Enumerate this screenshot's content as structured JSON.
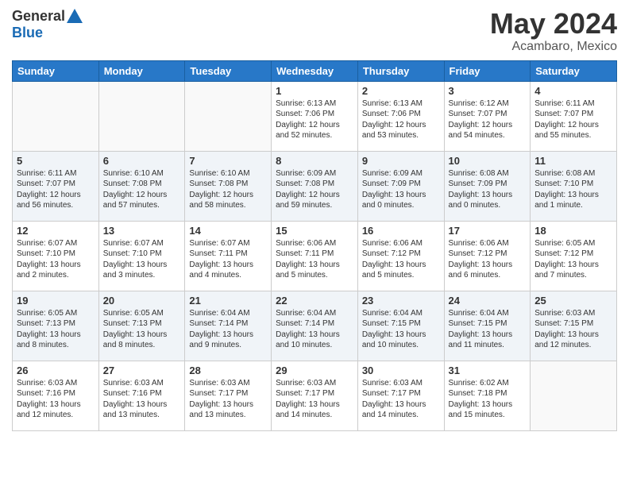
{
  "header": {
    "logo_general": "General",
    "logo_blue": "Blue",
    "title": "May 2024",
    "location": "Acambaro, Mexico"
  },
  "weekdays": [
    "Sunday",
    "Monday",
    "Tuesday",
    "Wednesday",
    "Thursday",
    "Friday",
    "Saturday"
  ],
  "weeks": [
    [
      {
        "day": "",
        "info": ""
      },
      {
        "day": "",
        "info": ""
      },
      {
        "day": "",
        "info": ""
      },
      {
        "day": "1",
        "info": "Sunrise: 6:13 AM\nSunset: 7:06 PM\nDaylight: 12 hours\nand 52 minutes."
      },
      {
        "day": "2",
        "info": "Sunrise: 6:13 AM\nSunset: 7:06 PM\nDaylight: 12 hours\nand 53 minutes."
      },
      {
        "day": "3",
        "info": "Sunrise: 6:12 AM\nSunset: 7:07 PM\nDaylight: 12 hours\nand 54 minutes."
      },
      {
        "day": "4",
        "info": "Sunrise: 6:11 AM\nSunset: 7:07 PM\nDaylight: 12 hours\nand 55 minutes."
      }
    ],
    [
      {
        "day": "5",
        "info": "Sunrise: 6:11 AM\nSunset: 7:07 PM\nDaylight: 12 hours\nand 56 minutes."
      },
      {
        "day": "6",
        "info": "Sunrise: 6:10 AM\nSunset: 7:08 PM\nDaylight: 12 hours\nand 57 minutes."
      },
      {
        "day": "7",
        "info": "Sunrise: 6:10 AM\nSunset: 7:08 PM\nDaylight: 12 hours\nand 58 minutes."
      },
      {
        "day": "8",
        "info": "Sunrise: 6:09 AM\nSunset: 7:08 PM\nDaylight: 12 hours\nand 59 minutes."
      },
      {
        "day": "9",
        "info": "Sunrise: 6:09 AM\nSunset: 7:09 PM\nDaylight: 13 hours\nand 0 minutes."
      },
      {
        "day": "10",
        "info": "Sunrise: 6:08 AM\nSunset: 7:09 PM\nDaylight: 13 hours\nand 0 minutes."
      },
      {
        "day": "11",
        "info": "Sunrise: 6:08 AM\nSunset: 7:10 PM\nDaylight: 13 hours\nand 1 minute."
      }
    ],
    [
      {
        "day": "12",
        "info": "Sunrise: 6:07 AM\nSunset: 7:10 PM\nDaylight: 13 hours\nand 2 minutes."
      },
      {
        "day": "13",
        "info": "Sunrise: 6:07 AM\nSunset: 7:10 PM\nDaylight: 13 hours\nand 3 minutes."
      },
      {
        "day": "14",
        "info": "Sunrise: 6:07 AM\nSunset: 7:11 PM\nDaylight: 13 hours\nand 4 minutes."
      },
      {
        "day": "15",
        "info": "Sunrise: 6:06 AM\nSunset: 7:11 PM\nDaylight: 13 hours\nand 5 minutes."
      },
      {
        "day": "16",
        "info": "Sunrise: 6:06 AM\nSunset: 7:12 PM\nDaylight: 13 hours\nand 5 minutes."
      },
      {
        "day": "17",
        "info": "Sunrise: 6:06 AM\nSunset: 7:12 PM\nDaylight: 13 hours\nand 6 minutes."
      },
      {
        "day": "18",
        "info": "Sunrise: 6:05 AM\nSunset: 7:12 PM\nDaylight: 13 hours\nand 7 minutes."
      }
    ],
    [
      {
        "day": "19",
        "info": "Sunrise: 6:05 AM\nSunset: 7:13 PM\nDaylight: 13 hours\nand 8 minutes."
      },
      {
        "day": "20",
        "info": "Sunrise: 6:05 AM\nSunset: 7:13 PM\nDaylight: 13 hours\nand 8 minutes."
      },
      {
        "day": "21",
        "info": "Sunrise: 6:04 AM\nSunset: 7:14 PM\nDaylight: 13 hours\nand 9 minutes."
      },
      {
        "day": "22",
        "info": "Sunrise: 6:04 AM\nSunset: 7:14 PM\nDaylight: 13 hours\nand 10 minutes."
      },
      {
        "day": "23",
        "info": "Sunrise: 6:04 AM\nSunset: 7:15 PM\nDaylight: 13 hours\nand 10 minutes."
      },
      {
        "day": "24",
        "info": "Sunrise: 6:04 AM\nSunset: 7:15 PM\nDaylight: 13 hours\nand 11 minutes."
      },
      {
        "day": "25",
        "info": "Sunrise: 6:03 AM\nSunset: 7:15 PM\nDaylight: 13 hours\nand 12 minutes."
      }
    ],
    [
      {
        "day": "26",
        "info": "Sunrise: 6:03 AM\nSunset: 7:16 PM\nDaylight: 13 hours\nand 12 minutes."
      },
      {
        "day": "27",
        "info": "Sunrise: 6:03 AM\nSunset: 7:16 PM\nDaylight: 13 hours\nand 13 minutes."
      },
      {
        "day": "28",
        "info": "Sunrise: 6:03 AM\nSunset: 7:17 PM\nDaylight: 13 hours\nand 13 minutes."
      },
      {
        "day": "29",
        "info": "Sunrise: 6:03 AM\nSunset: 7:17 PM\nDaylight: 13 hours\nand 14 minutes."
      },
      {
        "day": "30",
        "info": "Sunrise: 6:03 AM\nSunset: 7:17 PM\nDaylight: 13 hours\nand 14 minutes."
      },
      {
        "day": "31",
        "info": "Sunrise: 6:02 AM\nSunset: 7:18 PM\nDaylight: 13 hours\nand 15 minutes."
      },
      {
        "day": "",
        "info": ""
      }
    ]
  ]
}
